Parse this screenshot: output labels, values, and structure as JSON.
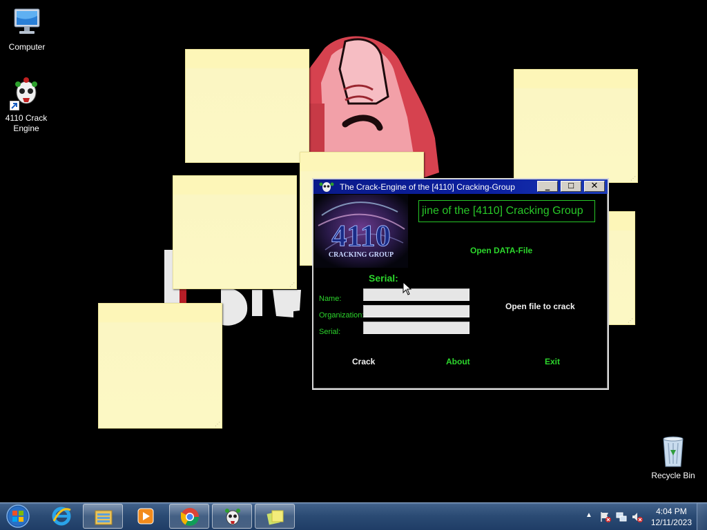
{
  "desktop": {
    "icons": [
      {
        "label": "Computer",
        "icon": "computer-icon"
      },
      {
        "label": "4110 Crack Engine",
        "icon": "skull-clown-icon"
      },
      {
        "label": "Recycle Bin",
        "icon": "recycle-bin-icon"
      }
    ],
    "wallpaper": "cartoon-hand-fist"
  },
  "crack_window": {
    "title": "The Crack-Engine of the [4110] Cracking-Group",
    "marquee": "jine of the [4110] Cracking Group",
    "logo_text": "4110",
    "logo_subtext": "CRACKING GROUP",
    "open_data_file": "Open DATA-File",
    "serial_heading": "Serial:",
    "fields": [
      {
        "label": "Name:",
        "value": ""
      },
      {
        "label": "Organization:",
        "value": ""
      },
      {
        "label": "Serial:",
        "value": ""
      }
    ],
    "open_file_to_crack": "Open file to crack",
    "buttons": {
      "crack": "Crack",
      "about": "About",
      "exit": "Exit"
    },
    "colors": {
      "accent_green": "#2cd62c",
      "title_bar": "#0a1a8a"
    }
  },
  "taskbar": {
    "start": "windows-start-orb",
    "apps": [
      {
        "name": "Internet Explorer",
        "icon": "internet-explorer-icon",
        "state": "pinned"
      },
      {
        "name": "Windows Explorer",
        "icon": "folder-library-icon",
        "state": "running"
      },
      {
        "name": "Windows Media Player",
        "icon": "media-player-icon",
        "state": "pinned"
      },
      {
        "name": "Google Chrome",
        "icon": "chrome-icon",
        "state": "running"
      },
      {
        "name": "4110 Crack Engine",
        "icon": "skull-clown-icon",
        "state": "running"
      },
      {
        "name": "Sticky Notes",
        "icon": "sticky-notes-icon",
        "state": "running"
      }
    ],
    "tray": {
      "icons": [
        "show-hidden-icons-arrow",
        "action-center-flag-icon",
        "network-icon",
        "volume-muted-icon"
      ],
      "time": "4:04 PM",
      "date": "12/11/2023"
    }
  },
  "sticky_notes": {
    "count": 7,
    "color": "#fdf6b8"
  }
}
